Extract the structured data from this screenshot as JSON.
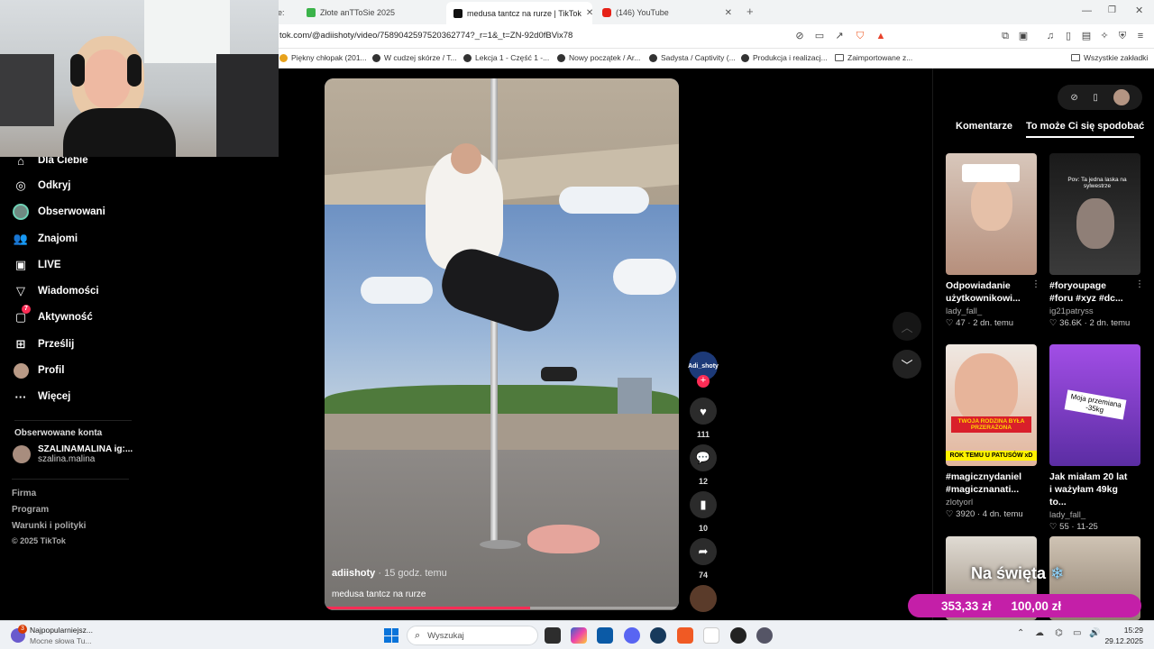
{
  "browser": {
    "tabs": [
      {
        "label": "e:"
      },
      {
        "label": "Złote anTToSie 2025"
      },
      {
        "label": "medusa tantcz na rurze | TikTok"
      },
      {
        "label": "(146) YouTube"
      }
    ],
    "new_tab": "+",
    "url": "tok.com/@adiishoty/video/7589042597520362774?_r=1&_t=ZN-92d0fBVix78",
    "bookmarks": [
      {
        "label": "Piękny chłopak (201..."
      },
      {
        "label": "W cudzej skórze / T..."
      },
      {
        "label": "Lekcja 1 - Część 1 -..."
      },
      {
        "label": "Nowy początek / Ar..."
      },
      {
        "label": "Sadysta / Captivity (..."
      },
      {
        "label": "Produkcja i realizacj..."
      },
      {
        "label": "Zaimportowane z..."
      },
      {
        "label": "Wszystkie zakładki"
      }
    ]
  },
  "sidebar": {
    "items": [
      {
        "label": "Dla Ciebie",
        "icon": "home-icon"
      },
      {
        "label": "Odkryj",
        "icon": "compass-icon"
      },
      {
        "label": "Obserwowani",
        "icon": "avatar"
      },
      {
        "label": "Znajomi",
        "icon": "friends-icon"
      },
      {
        "label": "LIVE",
        "icon": "live-icon"
      },
      {
        "label": "Wiadomości",
        "icon": "send-icon"
      },
      {
        "label": "Aktywność",
        "icon": "inbox-icon",
        "badge": "7"
      },
      {
        "label": "Prześlij",
        "icon": "upload-icon"
      },
      {
        "label": "Profil",
        "icon": "avatar"
      },
      {
        "label": "Więcej",
        "icon": "more-icon"
      }
    ],
    "following_heading": "Obserwowane konta",
    "following": [
      {
        "name": "SZALINAMALINA ig:...",
        "handle": "szalina.malina"
      }
    ],
    "footer": [
      "Firma",
      "Program",
      "Warunki i polityki",
      "© 2025 TikTok"
    ]
  },
  "video": {
    "author": "adiishoty",
    "time": "· 15 godz. temu",
    "caption": "medusa tantcz na rurze",
    "progress": 0.58,
    "avatar_label": "Adi_shoty",
    "likes": "111",
    "comments": "12",
    "saves": "10",
    "shares": "74"
  },
  "right_panel": {
    "tabs": [
      "Komentarze",
      "To może Ci się spodobać"
    ],
    "cards": [
      {
        "title": "Odpowiadanie użytkownikowi...",
        "user": "lady_fall_",
        "likes": "47",
        "date": "2 dn. temu",
        "overlay": "",
        "bg": "#c9a999"
      },
      {
        "title": "#foryoupage #foru #xyz #dc...",
        "user": "ig21patryss",
        "likes": "36.6K",
        "date": "2 dn. temu",
        "overlay": "Pov: Ta jedna laska na sylwestrze",
        "bg": "#2a2a2a"
      },
      {
        "title": "#magicznydaniel #magicznanati...",
        "user": "zlotyorl",
        "likes": "3920",
        "date": "4 dn. temu",
        "overlay": "TWOJA RODZINA BYŁA PRZERAŻONA",
        "overlay2": "ROK TEMU U PATUSÓW xD",
        "bg": "#e0b7a0"
      },
      {
        "title": "Jak miałam 20 lat i ważyłam 49kg to...",
        "user": "lady_fall_",
        "likes": "55",
        "date": "11-25",
        "overlay": "Moja przemiana -35kg",
        "bg": "#7b3fc4"
      },
      {
        "title": "",
        "user": "",
        "likes": "",
        "date": "",
        "overlay": "",
        "bg": "#d6cfc3"
      },
      {
        "title": "",
        "user": "",
        "likes": "",
        "date": "",
        "overlay": "",
        "bg": "#bfb2a0"
      }
    ],
    "promo_title": "Na święta",
    "promo_prices": [
      "353,33 zł",
      "100,00 zł"
    ]
  },
  "taskbar": {
    "news_badge": "3",
    "news_title": "Najpopularniejsz...",
    "news_sub": "Mocne słowa Tu...",
    "search_placeholder": "Wyszukaj",
    "time": "15:29",
    "date": "29.12.2025"
  },
  "colors": {
    "accent": "#fe2c55",
    "promo": "#c41fa8"
  }
}
